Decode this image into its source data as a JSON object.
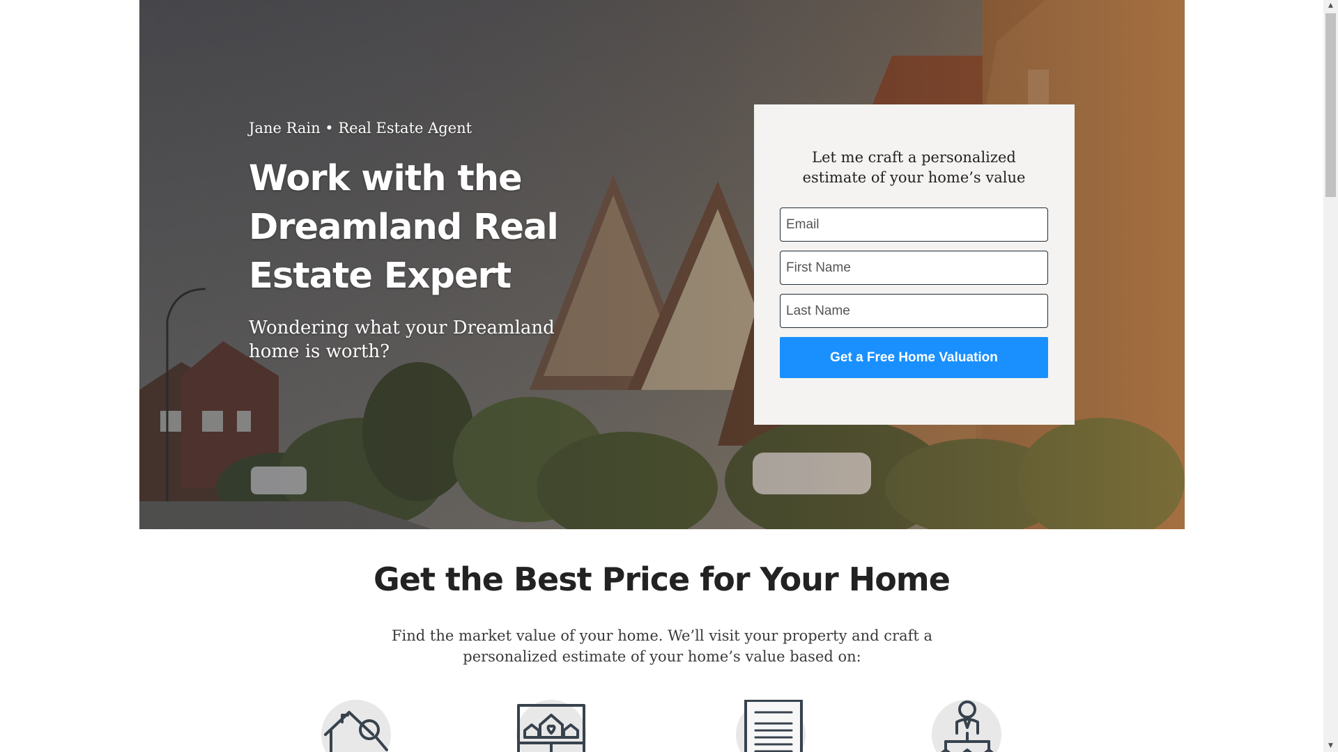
{
  "hero": {
    "agent_line": "Jane Rain • Real Estate Agent",
    "title": "Work with the Dreamland Real Estate Expert",
    "subtitle": "Wondering what your Dreamland home is worth?"
  },
  "form": {
    "heading": "Let me craft a personalized estimate of your home’s value",
    "email_placeholder": "Email",
    "first_name_placeholder": "First Name",
    "last_name_placeholder": "Last Name",
    "submit_label": "Get a Free Home Valuation"
  },
  "section": {
    "title": "Get the Best Price for Your Home",
    "description": "Find the market value of your home. We’ll visit your property and craft a personalized estimate of your home’s value based on:"
  },
  "features": [
    {
      "icon": "house-search-icon"
    },
    {
      "icon": "house-listing-sign-icon"
    },
    {
      "icon": "document-icon"
    },
    {
      "icon": "agent-network-icon"
    }
  ],
  "colors": {
    "accent": "#1a90ff",
    "card_background": "#f4f3f1",
    "heading_text": "#222222",
    "icon_stroke": "#37424d"
  }
}
